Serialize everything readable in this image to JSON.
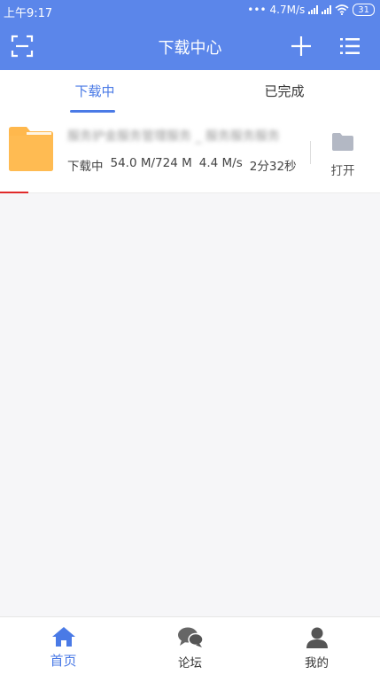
{
  "status": {
    "time": "上午9:17",
    "dots": "•••",
    "speed": "4.7M/s",
    "battery": "31"
  },
  "header": {
    "title": "下载中心",
    "icons": [
      "scan-icon",
      "plus-icon",
      "list-icon"
    ]
  },
  "tabs": [
    {
      "label": "下载中",
      "active": true
    },
    {
      "label": "已完成",
      "active": false
    }
  ],
  "downloads": [
    {
      "name": "服务护金服务管理服务 _ 服务服务服务",
      "status": "下载中",
      "size": "54.0 M/724 M",
      "speed": "4.4 M/s",
      "remaining": "2分32秒",
      "progress": 0.0746,
      "open_label": "打开"
    }
  ],
  "bottom_nav": [
    {
      "label": "首页",
      "icon": "home-icon",
      "active": true
    },
    {
      "label": "论坛",
      "icon": "forum-icon",
      "active": false
    },
    {
      "label": "我的",
      "icon": "profile-icon",
      "active": false
    }
  ],
  "colors": {
    "header_bg": "#5b86ea",
    "accent": "#4a7ae6",
    "folder": "#ffb84d",
    "progress": "#e02a2a"
  }
}
